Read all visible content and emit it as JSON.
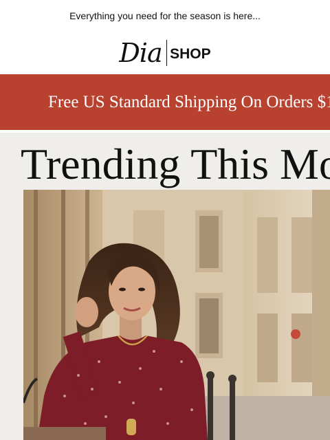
{
  "preheader": {
    "text": "Everything you need for the season is here..."
  },
  "logo": {
    "script": "Dia",
    "shop": "SHOP"
  },
  "banner": {
    "text": "Free US Standard Shipping On Orders $1",
    "background": "#b94130"
  },
  "hero": {
    "title": "Trending This Mo",
    "background": "#f0eeeb",
    "image_label": "woman-in-red-floral-dress-on-street-photo"
  }
}
